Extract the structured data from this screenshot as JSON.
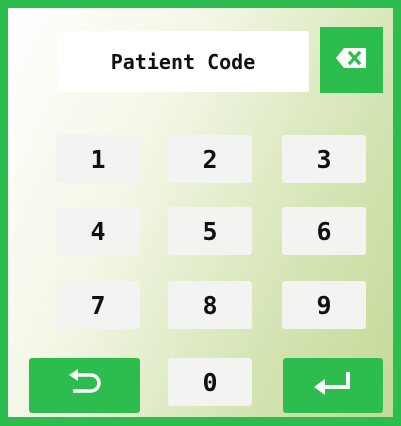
{
  "display": {
    "placeholder": "Patient Code"
  },
  "keys": [
    "1",
    "2",
    "3",
    "4",
    "5",
    "6",
    "7",
    "8",
    "9",
    "0"
  ],
  "icons": {
    "backspace": "backspace-icon",
    "back": "undo-arrow-icon",
    "enter": "enter-arrow-icon"
  },
  "colors": {
    "accent": "#2dbd4e",
    "key_bg": "#f3f3f1",
    "text": "#111111"
  }
}
